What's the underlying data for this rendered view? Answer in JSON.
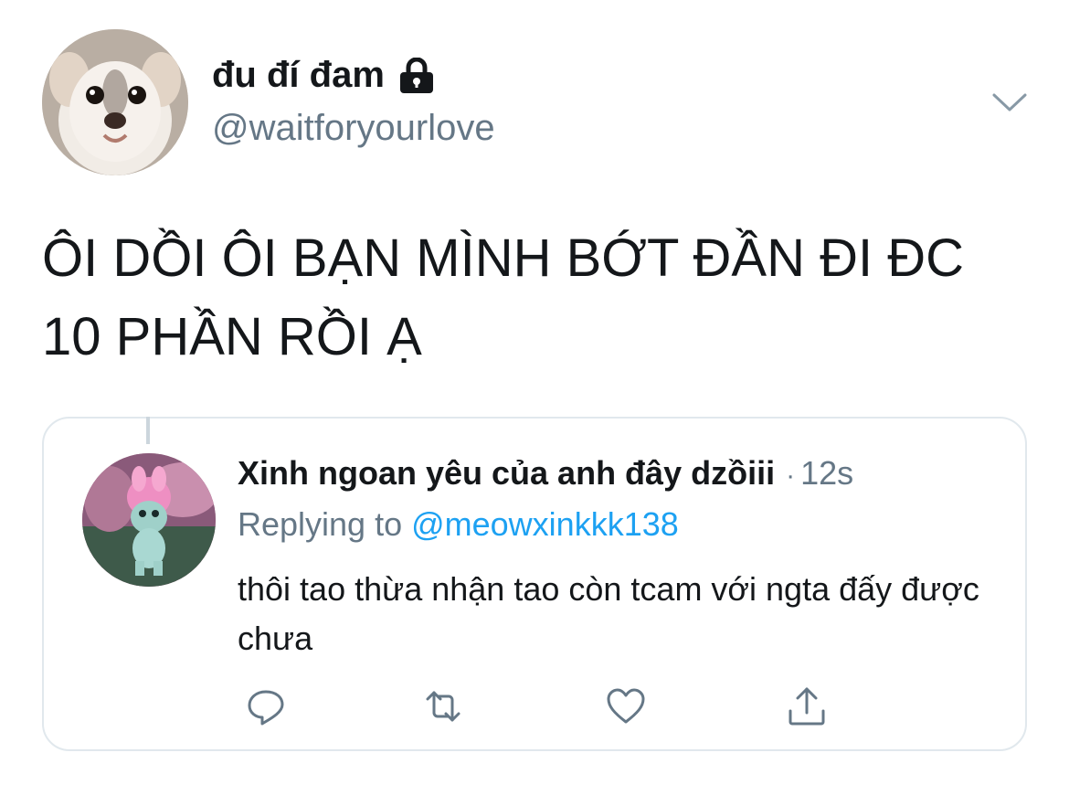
{
  "tweet": {
    "display_name": "đu đí đam",
    "handle": "@waitforyourlove",
    "text": "ÔI DỒI ÔI BẠN MÌNH BỚT ĐẦN ĐI ĐC 10 PHẦN RỒI Ạ",
    "icons": {
      "lock": "lock-icon",
      "more": "chevron-down-icon"
    }
  },
  "quoted": {
    "display_name": "Xinh ngoan yêu của anh đây dzồiii",
    "dot": "·",
    "time": "12s",
    "replying_prefix": "Replying to ",
    "replying_to": "@meowxinkkk138",
    "text": "thôi tao thừa nhận tao còn tcam với ngta đấy được chưa"
  },
  "actions": [
    {
      "name": "reply",
      "icon": "reply-icon"
    },
    {
      "name": "retweet",
      "icon": "retweet-icon"
    },
    {
      "name": "like",
      "icon": "heart-icon"
    },
    {
      "name": "share",
      "icon": "share-icon"
    }
  ],
  "colors": {
    "text": "#14171a",
    "secondary": "#657786",
    "link": "#1da1f2",
    "border": "#e1e8ed"
  }
}
